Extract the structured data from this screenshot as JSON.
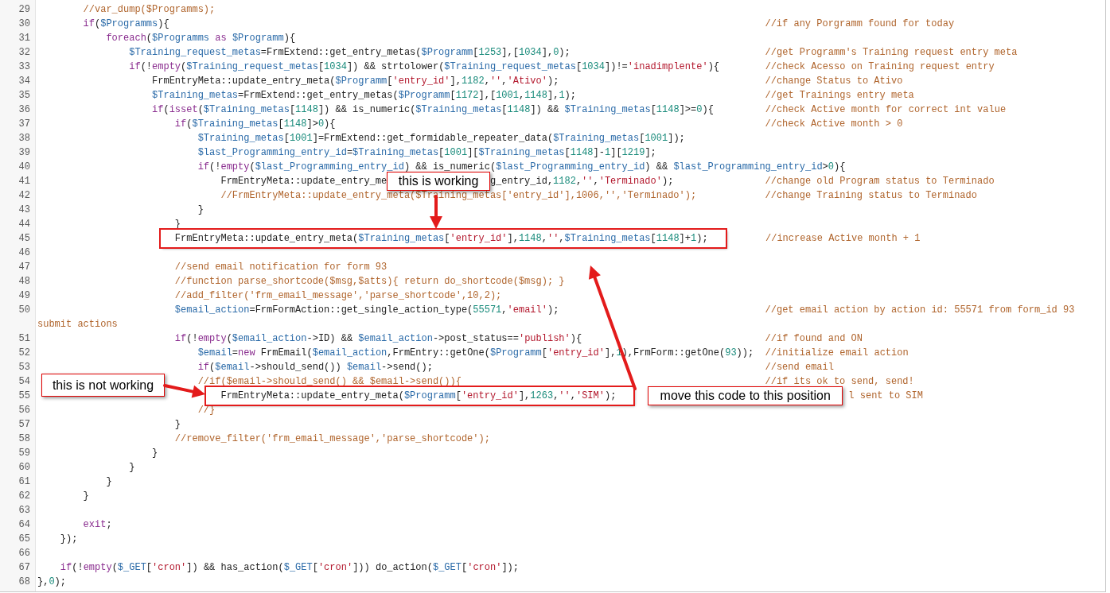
{
  "editor": {
    "lines": [
      {
        "number": "29",
        "segments": [
          {
            "kind": "code",
            "text": "        //var_dump($Programms);"
          }
        ]
      },
      {
        "number": "30",
        "segments": [
          {
            "kind": "code",
            "text": "        if($Programms){"
          },
          {
            "kind": "comment",
            "text": "//if any Porgramm found for today"
          }
        ]
      },
      {
        "number": "31",
        "segments": [
          {
            "kind": "code",
            "text": "            foreach($Programms as $Programm){"
          }
        ]
      },
      {
        "number": "32",
        "segments": [
          {
            "kind": "code",
            "text": "                $Training_request_metas=FrmExtend::get_entry_metas($Programm[1253],[1034],0);"
          },
          {
            "kind": "comment",
            "text": "//get Programm's Training request entry meta"
          }
        ]
      },
      {
        "number": "33",
        "segments": [
          {
            "kind": "code",
            "text": "                if(!empty($Training_request_metas[1034]) && strtolower($Training_request_metas[1034])!='inadimplente'){"
          },
          {
            "kind": "comment",
            "text": "//check Acesso on Training request entry"
          }
        ]
      },
      {
        "number": "34",
        "segments": [
          {
            "kind": "code",
            "text": "                    FrmEntryMeta::update_entry_meta($Programm['entry_id'],1182,'','Ativo');"
          },
          {
            "kind": "comment",
            "text": "//change Status to Ativo"
          }
        ]
      },
      {
        "number": "35",
        "segments": [
          {
            "kind": "code",
            "text": "                    $Training_metas=FrmExtend::get_entry_metas($Programm[1172],[1001,1148],1);"
          },
          {
            "kind": "comment",
            "text": "//get Trainings entry meta"
          }
        ]
      },
      {
        "number": "36",
        "segments": [
          {
            "kind": "code",
            "text": "                    if(isset($Training_metas[1148]) && is_numeric($Training_metas[1148]) && $Training_metas[1148]>=0){"
          },
          {
            "kind": "comment",
            "text": "//check Active month for correct int value"
          }
        ]
      },
      {
        "number": "37",
        "segments": [
          {
            "kind": "code",
            "text": "                        if($Training_metas[1148]>0){"
          },
          {
            "kind": "comment",
            "text": "//check Active month > 0"
          }
        ]
      },
      {
        "number": "38",
        "segments": [
          {
            "kind": "code",
            "text": "                            $Training_metas[1001]=FrmExtend::get_formidable_repeater_data($Training_metas[1001]);"
          }
        ]
      },
      {
        "number": "39",
        "segments": [
          {
            "kind": "code",
            "text": "                            $last_Programming_entry_id=$Training_metas[1001][$Training_metas[1148]-1][1219];"
          }
        ]
      },
      {
        "number": "40",
        "segments": [
          {
            "kind": "code",
            "text": "                            if(!empty($last_Programming_entry_id) && is_numeric($last_Programming_entry_id) && $last_Programming_entry_id>0){"
          }
        ]
      },
      {
        "number": "41",
        "segments": [
          {
            "kind": "code",
            "text": "                                FrmEntryMeta::update_entry_me"
          },
          {
            "kind": "callout",
            "text": "this is working"
          },
          {
            "kind": "code",
            "text": "g_entry_id,1182,'','Terminado');"
          },
          {
            "kind": "comment",
            "text": "//change old Program status to Terminado"
          }
        ]
      },
      {
        "number": "42",
        "segments": [
          {
            "kind": "code",
            "text": "                                //FrmEntryMeta::update_entry_meta($Training_metas['entry_id'],1006,'','Terminado');"
          },
          {
            "kind": "comment",
            "text": "//change Training status to Terminado"
          }
        ]
      },
      {
        "number": "43",
        "segments": [
          {
            "kind": "code",
            "text": "                            }"
          }
        ]
      },
      {
        "number": "44",
        "segments": [
          {
            "kind": "code",
            "text": "                        }"
          }
        ]
      },
      {
        "number": "45",
        "segments": [
          {
            "kind": "code",
            "text": "                        FrmEntryMeta::update_entry_meta($Training_metas['entry_id'],1148,'',$Training_metas[1148]+1);",
            "highlighted": true
          },
          {
            "kind": "comment",
            "text": "//increase Active month + 1"
          }
        ]
      },
      {
        "number": "46"
      },
      {
        "number": "47",
        "segments": [
          {
            "kind": "code",
            "text": "                        //send email notification for form 93"
          }
        ]
      },
      {
        "number": "48",
        "segments": [
          {
            "kind": "code",
            "text": "                        //function parse_shortcode($msg,$atts){ return do_shortcode($msg); }"
          }
        ]
      },
      {
        "number": "49",
        "segments": [
          {
            "kind": "code",
            "text": "                        //add_filter('frm_email_message','parse_shortcode',10,2);"
          }
        ]
      },
      {
        "number": "50",
        "segments": [
          {
            "kind": "code",
            "text": "                        $email_action=FrmFormAction::get_single_action_type(55571,'email');"
          },
          {
            "kind": "comment",
            "text": "//get email action by action id: 55571 from form_id 93"
          }
        ]
      },
      {
        "segments": [
          {
            "kind": "wrapped_comment",
            "text": "submit actions"
          }
        ]
      },
      {
        "number": "51",
        "segments": [
          {
            "kind": "code",
            "text": "                        if(!empty($email_action->ID) && $email_action->post_status=='publish'){"
          },
          {
            "kind": "comment",
            "text": "//if found and ON"
          }
        ]
      },
      {
        "number": "52",
        "segments": [
          {
            "kind": "code",
            "text": "                            $email=new FrmEmail($email_action,FrmEntry::getOne($Programm['entry_id'],1),FrmForm::getOne(93));"
          },
          {
            "kind": "comment",
            "text": "//initialize email action"
          }
        ]
      },
      {
        "number": "53",
        "segments": [
          {
            "kind": "code",
            "text": "                            if($email->should_send()) $email->send();"
          },
          {
            "kind": "comment",
            "text": "//send email"
          }
        ]
      },
      {
        "number": "54",
        "segments": [
          {
            "kind": "code",
            "text": "                            //if($email->should_send() && $email->send()){"
          },
          {
            "kind": "comment",
            "text": "//if its ok to send, send!"
          }
        ]
      },
      {
        "number": "55",
        "segments": [
          {
            "kind": "code",
            "text": "                                FrmEntryMeta::update_entry_meta($Programm['entry_id'],1263,'','SIM');",
            "highlighted": true
          },
          {
            "kind": "callout",
            "text": "move this code to this position"
          },
          {
            "kind": "comment",
            "text": "l sent to SIM"
          }
        ]
      },
      {
        "number": "56",
        "segments": [
          {
            "kind": "code",
            "text": "                            //}"
          }
        ]
      },
      {
        "number": "57",
        "segments": [
          {
            "kind": "code",
            "text": "                        }"
          }
        ]
      },
      {
        "number": "58",
        "segments": [
          {
            "kind": "code",
            "text": "                        //remove_filter('frm_email_message','parse_shortcode');"
          }
        ]
      },
      {
        "number": "59",
        "segments": [
          {
            "kind": "code",
            "text": "                    }"
          }
        ]
      },
      {
        "number": "60",
        "segments": [
          {
            "kind": "code",
            "text": "                }"
          }
        ]
      },
      {
        "number": "61",
        "segments": [
          {
            "kind": "code",
            "text": "            }"
          }
        ]
      },
      {
        "number": "62",
        "segments": [
          {
            "kind": "code",
            "text": "        }"
          }
        ]
      },
      {
        "number": "63"
      },
      {
        "number": "64",
        "segments": [
          {
            "kind": "code",
            "text": "        exit;"
          }
        ]
      },
      {
        "number": "65",
        "segments": [
          {
            "kind": "code",
            "text": "    });"
          }
        ]
      },
      {
        "number": "66"
      },
      {
        "number": "67",
        "segments": [
          {
            "kind": "code",
            "text": "    if(!empty($_GET['cron']) && has_action($_GET['cron'])) do_action($_GET['cron']);"
          }
        ]
      },
      {
        "number": "68",
        "segments": [
          {
            "kind": "code",
            "text": "},0);"
          }
        ]
      }
    ]
  },
  "floating_callouts": [
    {
      "text": "this is not working"
    }
  ]
}
